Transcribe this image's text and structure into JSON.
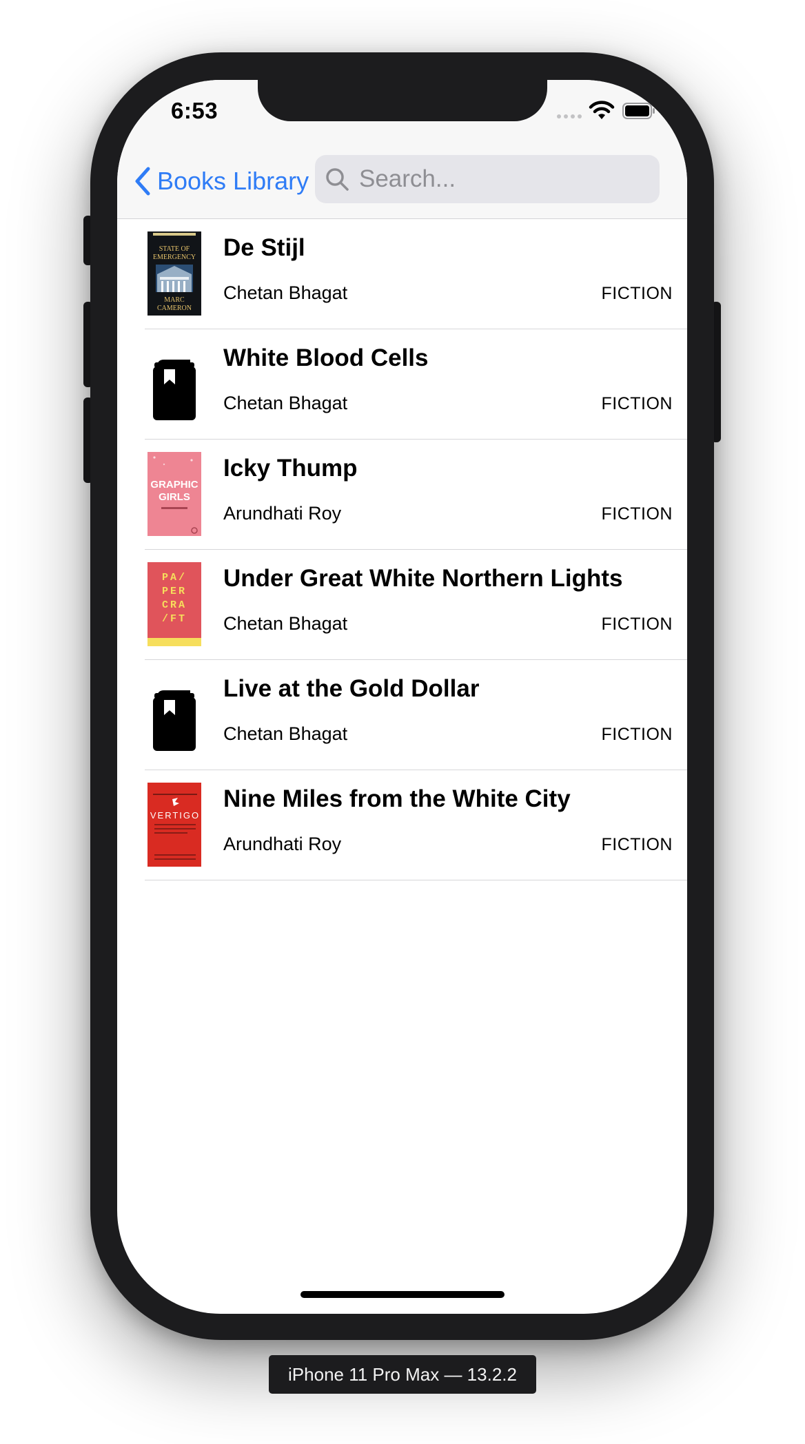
{
  "status_bar": {
    "time": "6:53"
  },
  "nav": {
    "back_label": "Books Library",
    "search_placeholder": "Search...",
    "search_value": "",
    "accent_color": "#2f7cf6"
  },
  "books": [
    {
      "title": "De Stijl",
      "author": "Chetan Bhagat",
      "genre": "FICTION",
      "cover": {
        "type": "image",
        "icon": "book-cover-state-of-emergency",
        "text": [
          "STATE OF",
          "EMERGENCY",
          "MARC",
          "CAMERON"
        ]
      }
    },
    {
      "title": "White Blood Cells",
      "author": "Chetan Bhagat",
      "genre": "FICTION",
      "cover": {
        "type": "placeholder",
        "icon": "book-bookmark-icon"
      }
    },
    {
      "title": "Icky Thump",
      "author": "Arundhati Roy",
      "genre": "FICTION",
      "cover": {
        "type": "image",
        "icon": "book-cover-graphic-girls",
        "text": [
          "GRAPHIC",
          "GIRLS"
        ]
      }
    },
    {
      "title": "Under Great White Northern Lights",
      "author": "Chetan Bhagat",
      "genre": "FICTION",
      "cover": {
        "type": "image",
        "icon": "book-cover-papercraft",
        "text": [
          "PA/",
          "PER",
          "CRA",
          "/FT"
        ]
      }
    },
    {
      "title": "Live at the Gold Dollar",
      "author": "Chetan Bhagat",
      "genre": "FICTION",
      "cover": {
        "type": "placeholder",
        "icon": "book-bookmark-icon"
      }
    },
    {
      "title": "Nine Miles from the White City",
      "author": "Arundhati Roy",
      "genre": "FICTION",
      "cover": {
        "type": "image",
        "icon": "book-cover-vertigo",
        "text": [
          "VERTIGO"
        ]
      }
    }
  ],
  "device": {
    "label": "iPhone 11 Pro Max — 13.2.2"
  }
}
